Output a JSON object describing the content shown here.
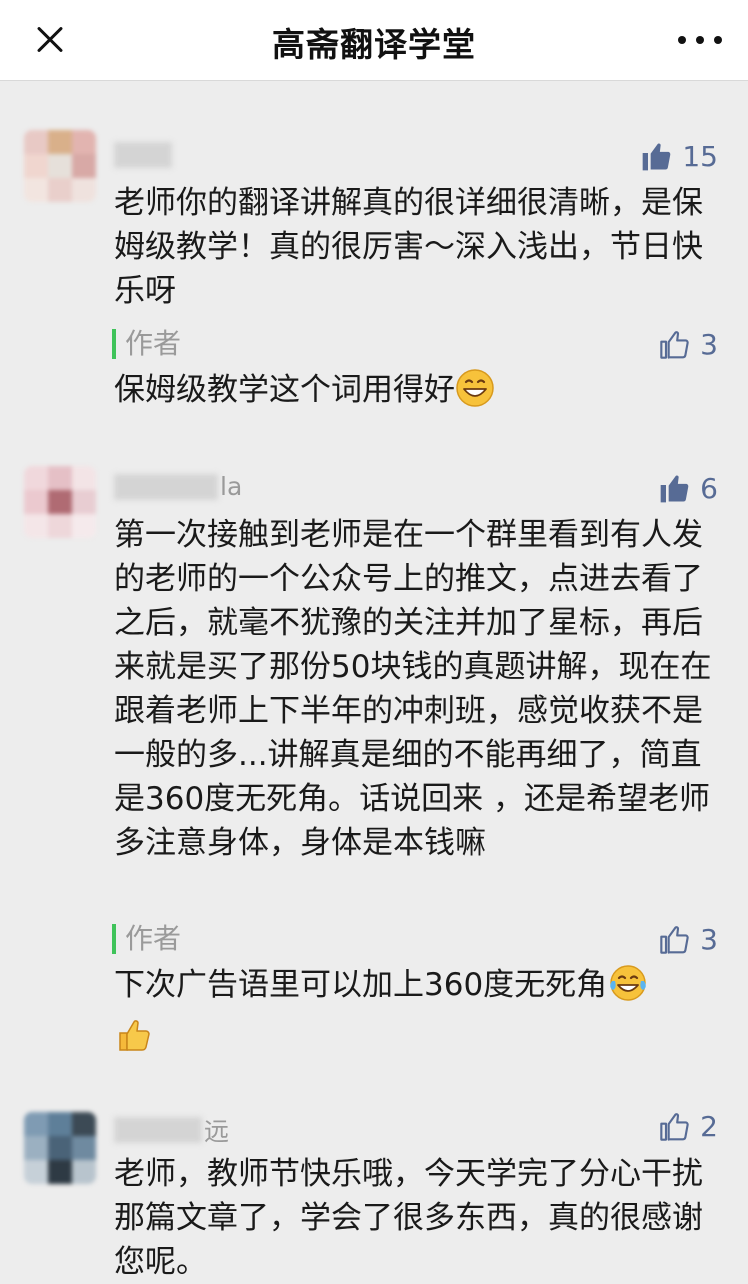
{
  "header": {
    "title": "高斋翻译学堂",
    "close_icon": "close-icon",
    "more_icon": "more-icon"
  },
  "comments": [
    {
      "username_visible": "",
      "likes": "15",
      "liked": true,
      "text": "老师你的翻译讲解真的很详细很清晰，是保姆级教学！真的很厉害～深入浅出，节日快乐呀",
      "reply": {
        "label": "作者",
        "likes": "3",
        "text": "保姆级教学这个词用得好",
        "emoji": "grinning-face-icon"
      }
    },
    {
      "username_visible": "la",
      "likes": "6",
      "liked": true,
      "text": "第一次接触到老师是在一个群里看到有人发的老师的一个公众号上的推文，点进去看了之后，就毫不犹豫的关注并加了星标，再后来就是买了那份50块钱的真题讲解，现在在跟着老师上下半年的冲刺班，感觉收获不是一般的多...讲解真是细的不能再细了，简直是360度无死角。话说回来 ，还是希望老师多注意身体，身体是本钱嘛",
      "reply": {
        "label": "作者",
        "likes": "3",
        "text": "下次广告语里可以加上360度无死角",
        "emoji": "tears-of-joy-icon",
        "emoji2": "thumbs-up-emoji-icon"
      }
    },
    {
      "username_visible": "远",
      "likes": "2",
      "liked": false,
      "text": "老师，教师节快乐哦，今天学完了分心干扰那篇文章了，学会了很多东西，真的很感谢您呢。"
    }
  ],
  "colors": {
    "link_blue": "#576b95",
    "author_bar": "#3fc35a",
    "background": "#ededed"
  }
}
